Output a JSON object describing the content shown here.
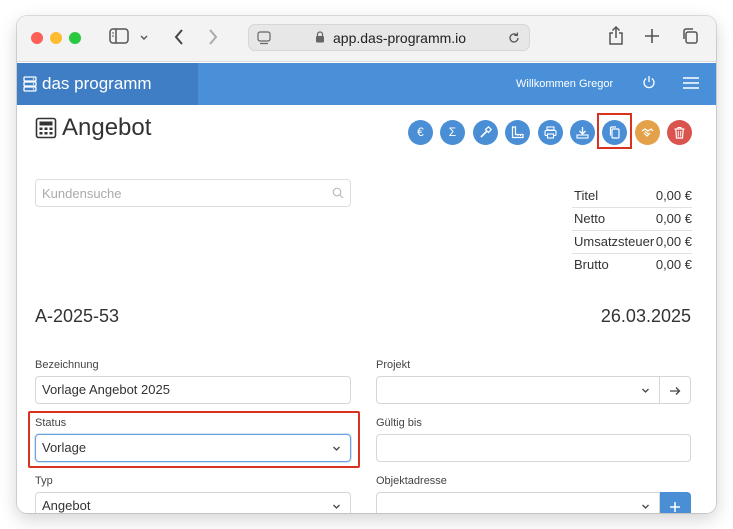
{
  "browser": {
    "url": "app.das-programm.io"
  },
  "app": {
    "brand": "das programm",
    "welcome": "Willkommen Gregor"
  },
  "page": {
    "title": "Angebot",
    "search_placeholder": "Kundensuche",
    "doc_number": "A-2025-53",
    "doc_date": "26.03.2025"
  },
  "actions": [
    {
      "name": "euro",
      "glyph": "€"
    },
    {
      "name": "sum",
      "glyph": "Σ"
    },
    {
      "name": "hammer",
      "glyph": ""
    },
    {
      "name": "ruler",
      "glyph": ""
    },
    {
      "name": "print",
      "glyph": ""
    },
    {
      "name": "download",
      "glyph": ""
    },
    {
      "name": "copy",
      "glyph": ""
    },
    {
      "name": "handshake",
      "glyph": ""
    },
    {
      "name": "trash",
      "glyph": ""
    }
  ],
  "totals": [
    {
      "label": "Titel",
      "value": "0,00 €"
    },
    {
      "label": "Netto",
      "value": "0,00 €"
    },
    {
      "label": "Umsatzsteuer",
      "value": "0,00 €"
    },
    {
      "label": "Brutto",
      "value": "0,00 €"
    }
  ],
  "form": {
    "bezeichnung": {
      "label": "Bezeichnung",
      "value": "Vorlage Angebot 2025"
    },
    "projekt": {
      "label": "Projekt",
      "value": ""
    },
    "status": {
      "label": "Status",
      "value": "Vorlage"
    },
    "gueltig_bis": {
      "label": "Gültig bis",
      "value": ""
    },
    "typ": {
      "label": "Typ",
      "value": "Angebot"
    },
    "objektadresse": {
      "label": "Objektadresse",
      "value": ""
    }
  },
  "colors": {
    "nav": "#4a90d9",
    "brand_bg": "#3f7ec4",
    "action_blue": "#4a8fd6",
    "action_orange": "#e3a24a",
    "action_red": "#d9534f",
    "highlight": "#d9321f"
  }
}
